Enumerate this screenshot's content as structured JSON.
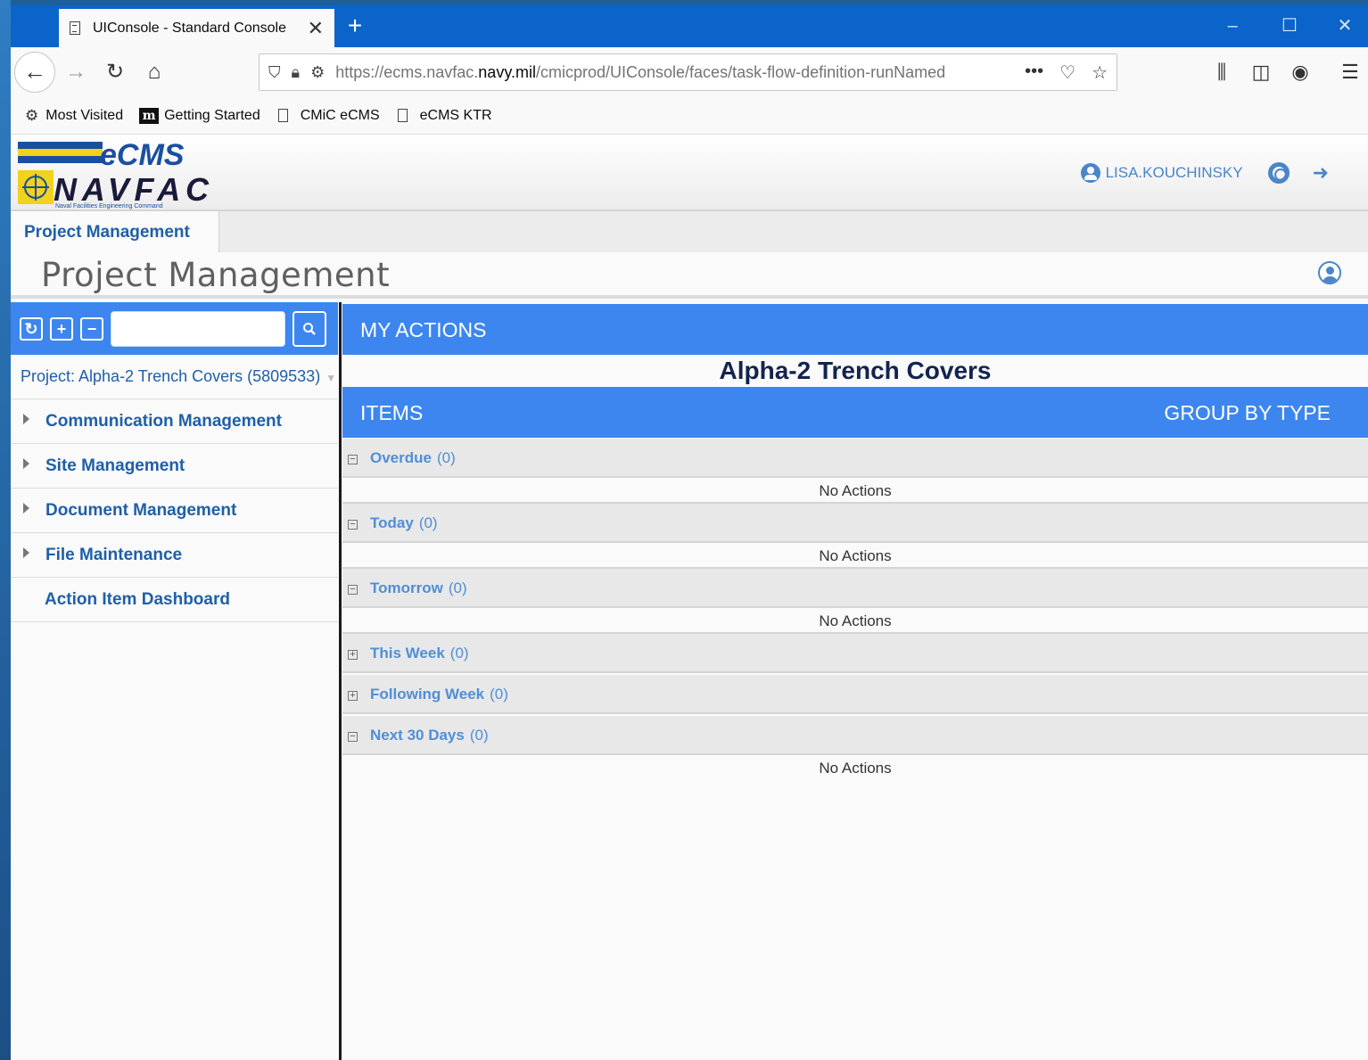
{
  "browser": {
    "tab_title": "UIConsole - Standard Console",
    "url_prefix": "https://ecms.navfac.",
    "url_domain": "navy.mil",
    "url_path": "/cmicprod/UIConsole/faces/task-flow-definition-runNamed",
    "bookmarks": [
      {
        "label": "Most Visited",
        "icon": "gear-icon"
      },
      {
        "label": "Getting Started",
        "icon": "m-logo-icon"
      },
      {
        "label": "CMiC eCMS",
        "icon": "page-icon"
      },
      {
        "label": "eCMS KTR",
        "icon": "page-icon"
      }
    ]
  },
  "header": {
    "logo_top": "eCMS",
    "logo_bottom": "NAVFAC",
    "logo_tagline": "Naval Facilities Engineering Command",
    "username": "LISA.KOUCHINSKY"
  },
  "module": {
    "tab_label": "Project Management",
    "page_title": "Project Management"
  },
  "sidebar": {
    "search_value": "",
    "project_label": "Project: Alpha-2 Trench Covers (5809533)",
    "items": [
      {
        "label": "Communication Management",
        "expandable": true
      },
      {
        "label": "Site Management",
        "expandable": true
      },
      {
        "label": "Document Management",
        "expandable": true
      },
      {
        "label": "File Maintenance",
        "expandable": true
      },
      {
        "label": "Action Item Dashboard",
        "expandable": false
      }
    ]
  },
  "main": {
    "section_title": "MY ACTIONS",
    "project_name": "Alpha-2 Trench Covers",
    "items_label": "ITEMS",
    "group_by_label": "GROUP BY TYPE",
    "empty_text": "No Actions",
    "groups": [
      {
        "label": "Overdue",
        "count": "(0)",
        "expanded": true
      },
      {
        "label": "Today",
        "count": "(0)",
        "expanded": true
      },
      {
        "label": "Tomorrow",
        "count": "(0)",
        "expanded": true
      },
      {
        "label": "This Week",
        "count": "(0)",
        "expanded": false
      },
      {
        "label": "Following Week",
        "count": "(0)",
        "expanded": false
      },
      {
        "label": "Next 30 Days",
        "count": "(0)",
        "expanded": true
      }
    ]
  },
  "colors": {
    "accent_blue": "#3d86f0",
    "link_blue": "#1f5fa8",
    "firefox_tabbar": "#0b64c9"
  }
}
